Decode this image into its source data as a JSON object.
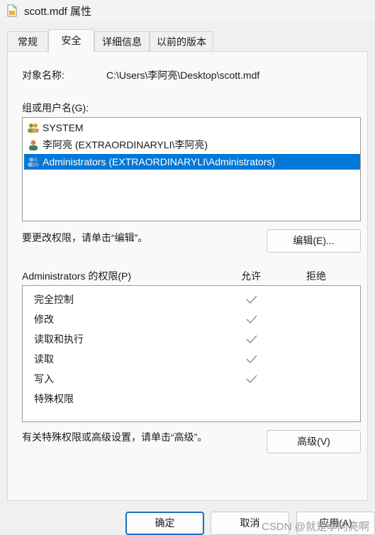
{
  "window": {
    "title": "scott.mdf 属性"
  },
  "tabs": [
    {
      "label": "常规"
    },
    {
      "label": "安全"
    },
    {
      "label": "详细信息"
    },
    {
      "label": "以前的版本"
    }
  ],
  "object": {
    "label": "对象名称:",
    "value": "C:\\Users\\李阿亮\\Desktop\\scott.mdf"
  },
  "groups": {
    "label": "组或用户名(G):",
    "items": [
      {
        "name": "SYSTEM"
      },
      {
        "name": "李阿亮 (EXTRAORDINARYLI\\李阿亮)"
      },
      {
        "name": "Administrators (EXTRAORDINARYLI\\Administrators)",
        "selected": true
      }
    ]
  },
  "edit": {
    "hint": "要更改权限，请单击“编辑”。",
    "button": "编辑(E)..."
  },
  "permissions": {
    "header": "Administrators 的权限(P)",
    "allow_label": "允许",
    "deny_label": "拒绝",
    "items": [
      {
        "name": "完全控制",
        "allow": true,
        "deny": false
      },
      {
        "name": "修改",
        "allow": true,
        "deny": false
      },
      {
        "name": "读取和执行",
        "allow": true,
        "deny": false
      },
      {
        "name": "读取",
        "allow": true,
        "deny": false
      },
      {
        "name": "写入",
        "allow": true,
        "deny": false
      },
      {
        "name": "特殊权限",
        "allow": false,
        "deny": false
      }
    ]
  },
  "advanced": {
    "hint": "有关特殊权限或高级设置，请单击“高级”。",
    "button": "高级(V)"
  },
  "footer": {
    "ok": "确定",
    "cancel": "取消",
    "apply": "应用(A)"
  },
  "watermark": "CSDN @就是李阿亮啊",
  "colors": {
    "selection": "#0078d7",
    "check": "#9a9a9a",
    "default_button_border": "#1a6fbf"
  }
}
